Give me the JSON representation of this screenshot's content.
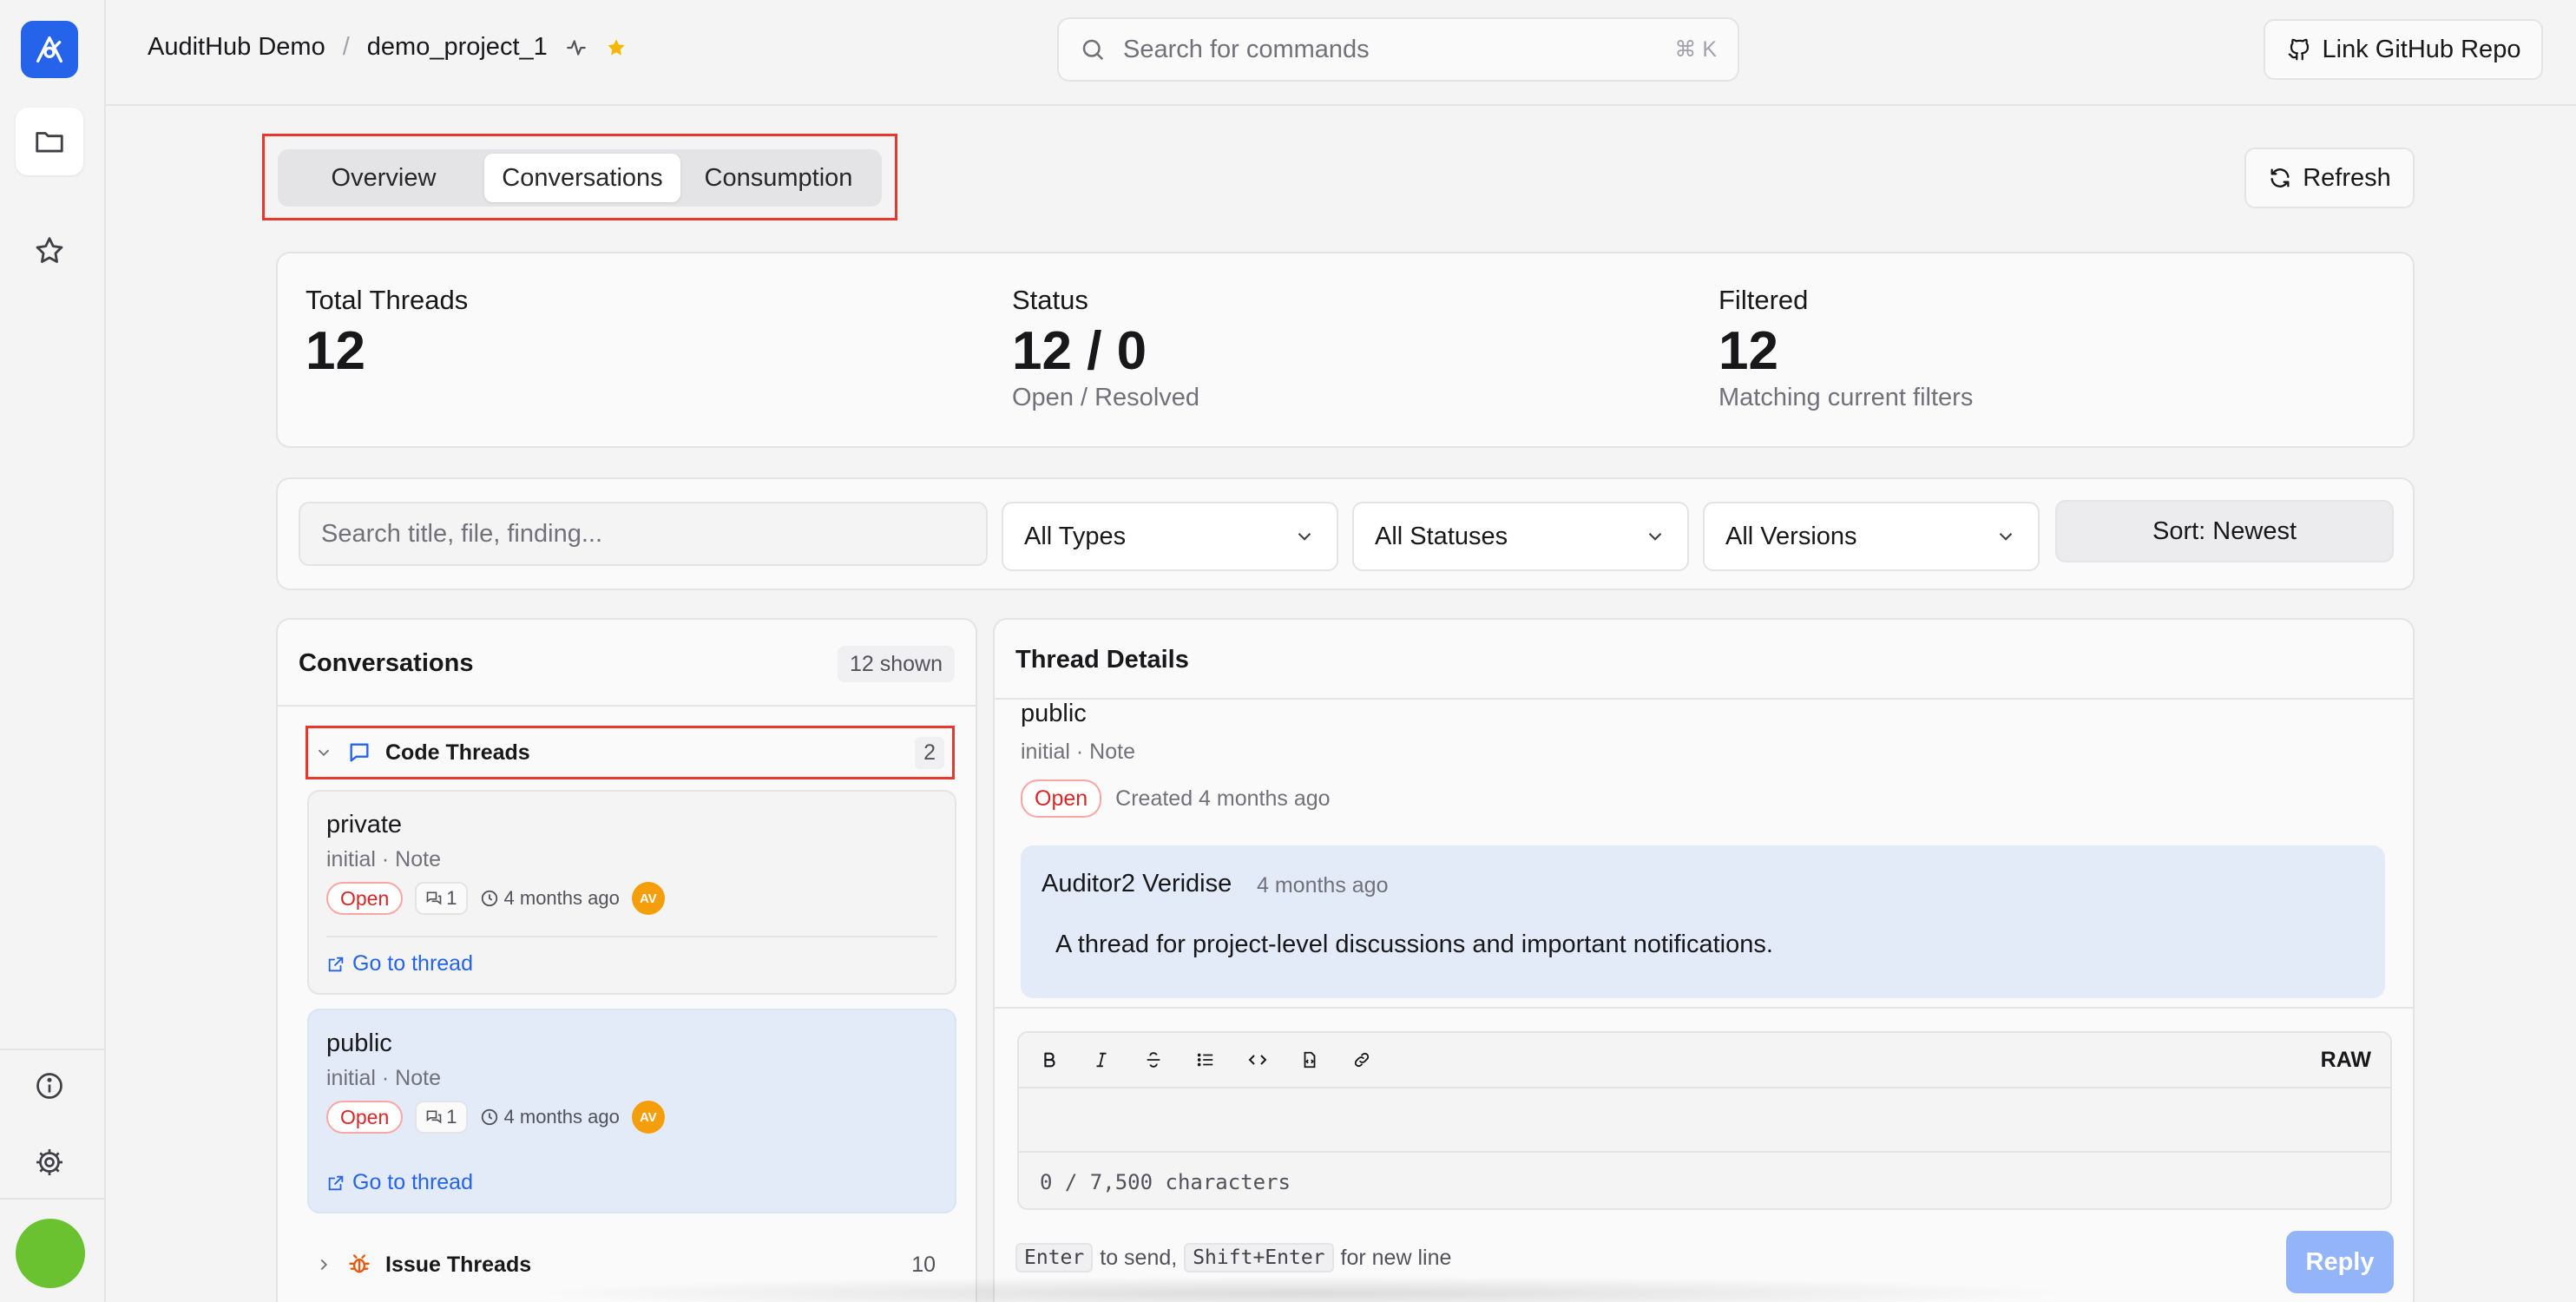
{
  "header": {
    "org": "AuditHub Demo",
    "separator": "/",
    "project": "demo_project_1",
    "search_placeholder": "Search for commands",
    "search_shortcut": "⌘ K",
    "github_button": "Link GitHub Repo"
  },
  "tabs": {
    "items": [
      "Overview",
      "Conversations",
      "Consumption"
    ],
    "active": "Conversations"
  },
  "refresh_label": "Refresh",
  "stats": {
    "total": {
      "label": "Total Threads",
      "value": "12"
    },
    "status": {
      "label": "Status",
      "value": "12 / 0",
      "sub": "Open / Resolved"
    },
    "filtered": {
      "label": "Filtered",
      "value": "12",
      "sub": "Matching current filters"
    }
  },
  "filters": {
    "search_placeholder": "Search title, file, finding...",
    "types": "All Types",
    "statuses": "All Statuses",
    "versions": "All Versions",
    "sort": "Sort: Newest"
  },
  "conversations": {
    "title": "Conversations",
    "shown": "12 shown",
    "groups": [
      {
        "label": "Code Threads",
        "count": "2",
        "expanded": true
      },
      {
        "label": "Issue Threads",
        "count": "10",
        "expanded": false
      }
    ],
    "threads": [
      {
        "title": "private",
        "meta": "initial · Note",
        "status": "Open",
        "replies": "1",
        "time": "4 months ago",
        "avatar": "AV",
        "link": "Go to thread"
      },
      {
        "title": "public",
        "meta": "initial · Note",
        "status": "Open",
        "replies": "1",
        "time": "4 months ago",
        "avatar": "AV",
        "link": "Go to thread"
      }
    ]
  },
  "details": {
    "title": "Thread Details",
    "name": "public",
    "meta": "initial · Note",
    "status": "Open",
    "created": "Created 4 months ago",
    "message": {
      "author": "Auditor2 Veridise",
      "time": "4 months ago",
      "body": "A thread for project-level discussions and important notifications."
    },
    "editor": {
      "raw_label": "RAW",
      "char_count": "0 / 7,500 characters"
    },
    "hint": {
      "key1": "Enter",
      "text1": "to send,",
      "key2": "Shift+Enter",
      "text2": "for new line"
    },
    "reply_label": "Reply"
  },
  "colors": {
    "accent": "#2563eb",
    "highlight_box": "#e8372c",
    "open_badge": "#dc2626",
    "avatar": "#f59e0b",
    "user_avatar": "#6bc230",
    "selected_card": "#e3eaf8",
    "star": "#f5b800"
  },
  "icons": {
    "rail": [
      "logo-icon",
      "folder-icon",
      "star-icon",
      "info-icon",
      "settings-icon"
    ],
    "header": [
      "activity-icon",
      "star-filled-icon",
      "search-icon",
      "github-icon"
    ],
    "groups": [
      "chat-bubble-icon",
      "bug-icon"
    ]
  }
}
